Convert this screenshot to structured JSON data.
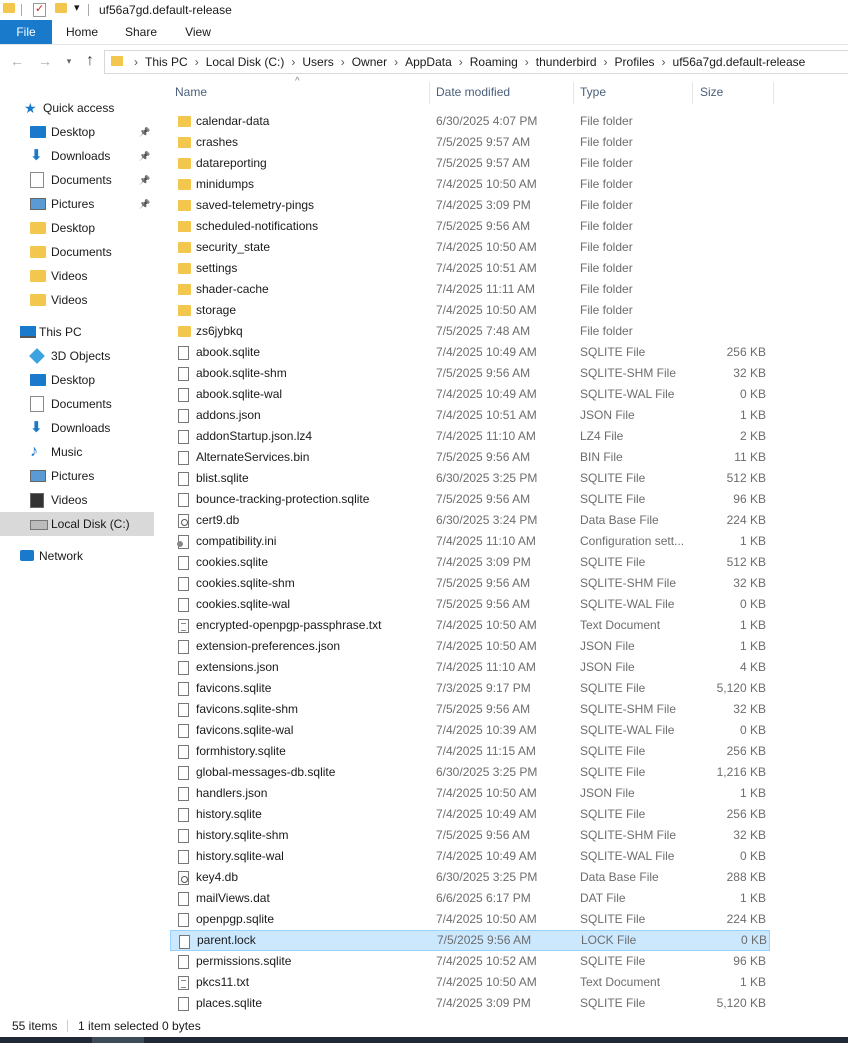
{
  "window": {
    "title": "uf56a7gd.default-release"
  },
  "ribbon": {
    "tabs": [
      "File",
      "Home",
      "Share",
      "View"
    ]
  },
  "address": {
    "crumbs": [
      "This PC",
      "Local Disk (C:)",
      "Users",
      "Owner",
      "AppData",
      "Roaming",
      "thunderbird",
      "Profiles",
      "uf56a7gd.default-release"
    ]
  },
  "nav": {
    "items": [
      {
        "label": "Quick access",
        "icon": "star-icon",
        "pinned": false
      },
      {
        "label": "Desktop",
        "icon": "desktop-icon",
        "pinned": true
      },
      {
        "label": "Downloads",
        "icon": "download-icon",
        "pinned": true
      },
      {
        "label": "Documents",
        "icon": "documents-icon",
        "pinned": true
      },
      {
        "label": "Pictures",
        "icon": "pictures-icon",
        "pinned": true
      },
      {
        "label": "Desktop",
        "icon": "folder-icon",
        "pinned": false
      },
      {
        "label": "Documents",
        "icon": "folder-icon",
        "pinned": false
      },
      {
        "label": "Videos",
        "icon": "folder-icon",
        "pinned": false
      },
      {
        "label": "Videos",
        "icon": "folder-icon",
        "pinned": false
      },
      {
        "label": "This PC",
        "icon": "computer-icon",
        "pinned": false
      },
      {
        "label": "3D Objects",
        "icon": "3d-objects-icon",
        "pinned": false
      },
      {
        "label": "Desktop",
        "icon": "desktop-icon",
        "pinned": false
      },
      {
        "label": "Documents",
        "icon": "documents-icon",
        "pinned": false
      },
      {
        "label": "Downloads",
        "icon": "download-icon",
        "pinned": false
      },
      {
        "label": "Music",
        "icon": "music-icon",
        "pinned": false
      },
      {
        "label": "Pictures",
        "icon": "pictures-icon",
        "pinned": false
      },
      {
        "label": "Videos",
        "icon": "videos-icon",
        "pinned": false
      },
      {
        "label": "Local Disk (C:)",
        "icon": "drive-icon",
        "pinned": false,
        "selected": true
      },
      {
        "label": "Network",
        "icon": "network-icon",
        "pinned": false
      }
    ]
  },
  "columns": {
    "name": "Name",
    "date": "Date modified",
    "type": "Type",
    "size": "Size"
  },
  "files": [
    {
      "name": "calendar-data",
      "date": "6/30/2025 4:07 PM",
      "type": "File folder",
      "size": "",
      "icon": "folder"
    },
    {
      "name": "crashes",
      "date": "7/5/2025 9:57 AM",
      "type": "File folder",
      "size": "",
      "icon": "folder"
    },
    {
      "name": "datareporting",
      "date": "7/5/2025 9:57 AM",
      "type": "File folder",
      "size": "",
      "icon": "folder"
    },
    {
      "name": "minidumps",
      "date": "7/4/2025 10:50 AM",
      "type": "File folder",
      "size": "",
      "icon": "folder"
    },
    {
      "name": "saved-telemetry-pings",
      "date": "7/4/2025 3:09 PM",
      "type": "File folder",
      "size": "",
      "icon": "folder"
    },
    {
      "name": "scheduled-notifications",
      "date": "7/5/2025 9:56 AM",
      "type": "File folder",
      "size": "",
      "icon": "folder"
    },
    {
      "name": "security_state",
      "date": "7/4/2025 10:50 AM",
      "type": "File folder",
      "size": "",
      "icon": "folder"
    },
    {
      "name": "settings",
      "date": "7/4/2025 10:51 AM",
      "type": "File folder",
      "size": "",
      "icon": "folder"
    },
    {
      "name": "shader-cache",
      "date": "7/4/2025 11:11 AM",
      "type": "File folder",
      "size": "",
      "icon": "folder"
    },
    {
      "name": "storage",
      "date": "7/4/2025 10:50 AM",
      "type": "File folder",
      "size": "",
      "icon": "folder"
    },
    {
      "name": "zs6jybkq",
      "date": "7/5/2025 7:48 AM",
      "type": "File folder",
      "size": "",
      "icon": "folder"
    },
    {
      "name": "abook.sqlite",
      "date": "7/4/2025 10:49 AM",
      "type": "SQLITE File",
      "size": "256 KB",
      "icon": "file"
    },
    {
      "name": "abook.sqlite-shm",
      "date": "7/5/2025 9:56 AM",
      "type": "SQLITE-SHM File",
      "size": "32 KB",
      "icon": "file"
    },
    {
      "name": "abook.sqlite-wal",
      "date": "7/4/2025 10:49 AM",
      "type": "SQLITE-WAL File",
      "size": "0 KB",
      "icon": "file"
    },
    {
      "name": "addons.json",
      "date": "7/4/2025 10:51 AM",
      "type": "JSON File",
      "size": "1 KB",
      "icon": "file"
    },
    {
      "name": "addonStartup.json.lz4",
      "date": "7/4/2025 11:10 AM",
      "type": "LZ4 File",
      "size": "2 KB",
      "icon": "file"
    },
    {
      "name": "AlternateServices.bin",
      "date": "7/5/2025 9:56 AM",
      "type": "BIN File",
      "size": "11 KB",
      "icon": "file"
    },
    {
      "name": "blist.sqlite",
      "date": "6/30/2025 3:25 PM",
      "type": "SQLITE File",
      "size": "512 KB",
      "icon": "file"
    },
    {
      "name": "bounce-tracking-protection.sqlite",
      "date": "7/5/2025 9:56 AM",
      "type": "SQLITE File",
      "size": "96 KB",
      "icon": "file"
    },
    {
      "name": "cert9.db",
      "date": "6/30/2025 3:24 PM",
      "type": "Data Base File",
      "size": "224 KB",
      "icon": "cert"
    },
    {
      "name": "compatibility.ini",
      "date": "7/4/2025 11:10 AM",
      "type": "Configuration sett...",
      "size": "1 KB",
      "icon": "ini"
    },
    {
      "name": "cookies.sqlite",
      "date": "7/4/2025 3:09 PM",
      "type": "SQLITE File",
      "size": "512 KB",
      "icon": "file"
    },
    {
      "name": "cookies.sqlite-shm",
      "date": "7/5/2025 9:56 AM",
      "type": "SQLITE-SHM File",
      "size": "32 KB",
      "icon": "file"
    },
    {
      "name": "cookies.sqlite-wal",
      "date": "7/5/2025 9:56 AM",
      "type": "SQLITE-WAL File",
      "size": "0 KB",
      "icon": "file"
    },
    {
      "name": "encrypted-openpgp-passphrase.txt",
      "date": "7/4/2025 10:50 AM",
      "type": "Text Document",
      "size": "1 KB",
      "icon": "txt"
    },
    {
      "name": "extension-preferences.json",
      "date": "7/4/2025 10:50 AM",
      "type": "JSON File",
      "size": "1 KB",
      "icon": "file"
    },
    {
      "name": "extensions.json",
      "date": "7/4/2025 11:10 AM",
      "type": "JSON File",
      "size": "4 KB",
      "icon": "file"
    },
    {
      "name": "favicons.sqlite",
      "date": "7/3/2025 9:17 PM",
      "type": "SQLITE File",
      "size": "5,120 KB",
      "icon": "file"
    },
    {
      "name": "favicons.sqlite-shm",
      "date": "7/5/2025 9:56 AM",
      "type": "SQLITE-SHM File",
      "size": "32 KB",
      "icon": "file"
    },
    {
      "name": "favicons.sqlite-wal",
      "date": "7/4/2025 10:39 AM",
      "type": "SQLITE-WAL File",
      "size": "0 KB",
      "icon": "file"
    },
    {
      "name": "formhistory.sqlite",
      "date": "7/4/2025 11:15 AM",
      "type": "SQLITE File",
      "size": "256 KB",
      "icon": "file"
    },
    {
      "name": "global-messages-db.sqlite",
      "date": "6/30/2025 3:25 PM",
      "type": "SQLITE File",
      "size": "1,216 KB",
      "icon": "file"
    },
    {
      "name": "handlers.json",
      "date": "7/4/2025 10:50 AM",
      "type": "JSON File",
      "size": "1 KB",
      "icon": "file"
    },
    {
      "name": "history.sqlite",
      "date": "7/4/2025 10:49 AM",
      "type": "SQLITE File",
      "size": "256 KB",
      "icon": "file"
    },
    {
      "name": "history.sqlite-shm",
      "date": "7/5/2025 9:56 AM",
      "type": "SQLITE-SHM File",
      "size": "32 KB",
      "icon": "file"
    },
    {
      "name": "history.sqlite-wal",
      "date": "7/4/2025 10:49 AM",
      "type": "SQLITE-WAL File",
      "size": "0 KB",
      "icon": "file"
    },
    {
      "name": "key4.db",
      "date": "6/30/2025 3:25 PM",
      "type": "Data Base File",
      "size": "288 KB",
      "icon": "cert"
    },
    {
      "name": "mailViews.dat",
      "date": "6/6/2025 6:17 PM",
      "type": "DAT File",
      "size": "1 KB",
      "icon": "file"
    },
    {
      "name": "openpgp.sqlite",
      "date": "7/4/2025 10:50 AM",
      "type": "SQLITE File",
      "size": "224 KB",
      "icon": "file"
    },
    {
      "name": "parent.lock",
      "date": "7/5/2025 9:56 AM",
      "type": "LOCK File",
      "size": "0 KB",
      "icon": "file",
      "selected": true
    },
    {
      "name": "permissions.sqlite",
      "date": "7/4/2025 10:52 AM",
      "type": "SQLITE File",
      "size": "96 KB",
      "icon": "file"
    },
    {
      "name": "pkcs11.txt",
      "date": "7/4/2025 10:50 AM",
      "type": "Text Document",
      "size": "1 KB",
      "icon": "txt"
    },
    {
      "name": "places.sqlite",
      "date": "7/4/2025 3:09 PM",
      "type": "SQLITE File",
      "size": "5,120 KB",
      "icon": "file"
    }
  ],
  "status": {
    "count": "55 items",
    "selection": "1 item selected  0 bytes"
  },
  "colors": {
    "accent": "#1979ca",
    "selection": "#cce8ff",
    "folder": "#f3c74d"
  }
}
